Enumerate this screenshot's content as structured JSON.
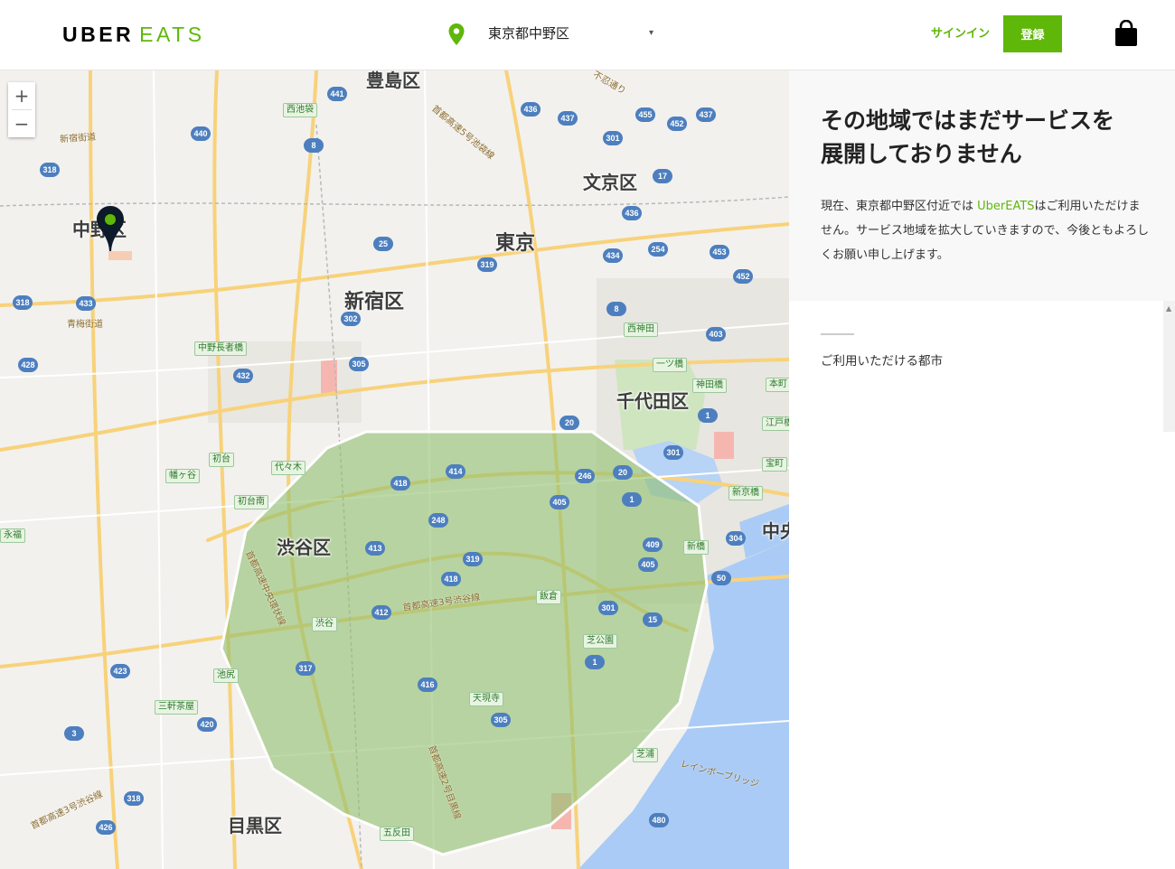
{
  "header": {
    "logo_uber": "UBER",
    "logo_eats": "EATS",
    "location": "東京都中野区",
    "location_caret": "▾",
    "signin_label": "サインイン",
    "register_label": "登録"
  },
  "map": {
    "zoom_in": "+",
    "zoom_out": "−",
    "wards": {
      "toshima": "豊島区",
      "bunkyo": "文京区",
      "tokyo": "東京",
      "shinjuku": "新宿区",
      "chiyoda": "千代田区",
      "shibuya": "渋谷区",
      "meguro": "目黒区",
      "nakano": "中野区",
      "chuo": "中央"
    },
    "stations": [
      "西池袋",
      "中野長者橋",
      "初台",
      "幡ヶ谷",
      "初台南",
      "代々木",
      "渋谷",
      "池尻",
      "三軒茶屋",
      "永福",
      "西神田",
      "一ツ橋",
      "神田橋",
      "本町",
      "江戸橋",
      "宝町",
      "新京橋",
      "新橋",
      "芝公園",
      "飯倉",
      "天現寺",
      "芝浦",
      "五反田"
    ],
    "routes": [
      "441",
      "440",
      "318",
      "8",
      "25",
      "433",
      "318",
      "428",
      "302",
      "432",
      "305",
      "319",
      "436",
      "437",
      "301",
      "455",
      "452",
      "437",
      "17",
      "436",
      "254",
      "434",
      "453",
      "452",
      "8",
      "403",
      "20",
      "301",
      "1",
      "246",
      "414",
      "418",
      "405",
      "20",
      "1",
      "248",
      "413",
      "319",
      "409",
      "405",
      "418",
      "301",
      "15",
      "304",
      "50",
      "412",
      "317",
      "416",
      "305",
      "1",
      "423",
      "420",
      "3",
      "318",
      "426",
      "480"
    ],
    "highways": [
      "首都高速5号池袋線",
      "首都高速3号渋谷線",
      "首都高速中央環状線",
      "首都高速2号目黒線",
      "首都高速3号渋谷線",
      "新宿街道",
      "青梅街道",
      "レインボーブリッジ",
      "不忍通り"
    ],
    "colors": {
      "service_area": "#8fbf6e",
      "service_border": "#ffffff"
    }
  },
  "panel": {
    "title_line1": "その地域ではまだサービスを",
    "title_line2": "展開しておりません",
    "desc_pre": "現在、東京都中野区付近では ",
    "desc_brand": "UberEATS",
    "desc_post": "はご利用いただけません。サービス地域を拡大していきますので、今後ともよろしくお願い申し上げます。",
    "cities_label": "ご利用いただける都市"
  },
  "colors": {
    "brand_green": "#5fb709"
  }
}
